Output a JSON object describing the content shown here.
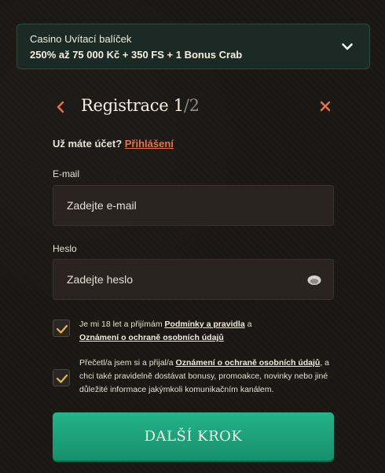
{
  "bonus": {
    "title": "Casino Uvítací balíček",
    "text": "250% až 75 000 Kč + 350 FS + 1 Bonus Crab",
    "toggle_icon": "chevron-down-icon"
  },
  "header": {
    "title": "Registrace",
    "step_current": "1",
    "step_separator": "/",
    "step_total": "2",
    "back_icon": "chevron-left-icon",
    "close_icon": "close-icon"
  },
  "account": {
    "question": "Už máte účet?",
    "login_link": "Přihlášení"
  },
  "email": {
    "label": "E-mail",
    "placeholder": "Zadejte e-mail",
    "value": ""
  },
  "password": {
    "label": "Heslo",
    "placeholder": "Zadejte heslo",
    "value": "",
    "eye_icon": "eye-icon"
  },
  "consents": [
    {
      "checked": true,
      "text_before": "Je mi 18 let a přijímám ",
      "link1": "Podmínky a pravidla",
      "text_mid": " a",
      "link2": "Oznámení o ochraně osobních údajů"
    },
    {
      "checked": true,
      "text_before": "Přečetl/a jsem si a přijal/a ",
      "link1": "Oznámení o ochraně osobních údajů",
      "text_after": ", a chci také pravidelně dostávat bonusy, promoakce, novinky nebo jiné důležité informace jakýmkoli komunikačním kanálem."
    }
  ],
  "submit_label": "DALŠÍ KROK",
  "colors": {
    "accent": "#e8734a",
    "check": "#e8b84a",
    "button": "#1fa37d",
    "background": "#1b1714",
    "bonus_bg": "#1c2a25"
  }
}
